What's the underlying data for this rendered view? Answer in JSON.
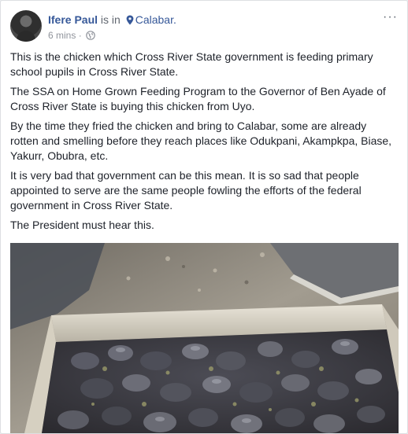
{
  "post": {
    "author": "Ifere Paul",
    "is_in": "is in",
    "location": "Calabar.",
    "time": "6 mins",
    "more_label": "···",
    "paragraphs": [
      "This is the chicken which Cross River State government is feeding primary school pupils in Cross River State.",
      "The SSA on Home Grown Feeding Program to the Governor of Ben Ayade of Cross River State is buying this chicken from Uyo.",
      "By the time they fried the chicken and bring to Calabar, some are already rotten and smelling before they reach places like Odukpani, Akampkpa, Biase, Yakurr, Obubra, etc.",
      "It is very bad that government can be this mean. It is so sad that people appointed to serve are the same people fowling the efforts of the federal government in Cross River State.",
      "The President must hear this."
    ]
  },
  "colors": {
    "link": "#365899",
    "meta": "#90949c",
    "text": "#1d2129"
  },
  "icons": {
    "location": "map-pin-icon",
    "privacy": "globe-icon",
    "menu": "more-options-icon"
  }
}
